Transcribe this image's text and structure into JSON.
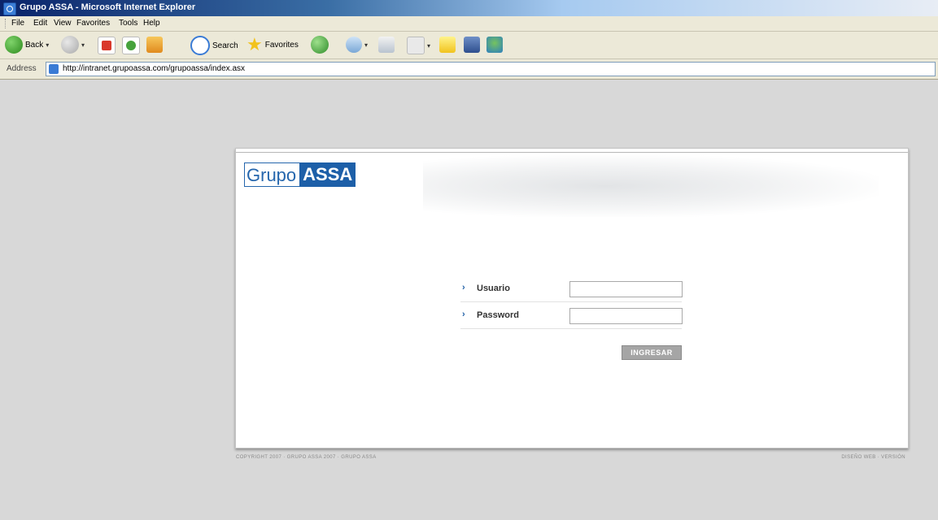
{
  "window": {
    "title": "Grupo ASSA - Microsoft Internet Explorer"
  },
  "menu": [
    "File",
    "Edit",
    "View",
    "Favorites",
    "Tools",
    "Help"
  ],
  "toolbar": {
    "back_label": "Back",
    "search_label": "Search",
    "favorites_label": "Favorites"
  },
  "address": {
    "label": "Address",
    "url": "http://intranet.grupoassa.com/grupoassa/index.asx"
  },
  "logo": {
    "part1": "Grupo",
    "part2": "ASSA"
  },
  "form": {
    "user_label": "Usuario",
    "password_label": "Password",
    "submit_label": "INGRESAR"
  },
  "footer": {
    "left": "COPYRIGHT 2007 · GRUPO ASSA 2007 · GRUPO ASSA",
    "right": "DISEÑO WEB · VERSIÓN"
  },
  "colors": {
    "brand_blue": "#1d5fa8",
    "page_bg": "#d8d8d8",
    "ie_title": "#0a246a"
  }
}
